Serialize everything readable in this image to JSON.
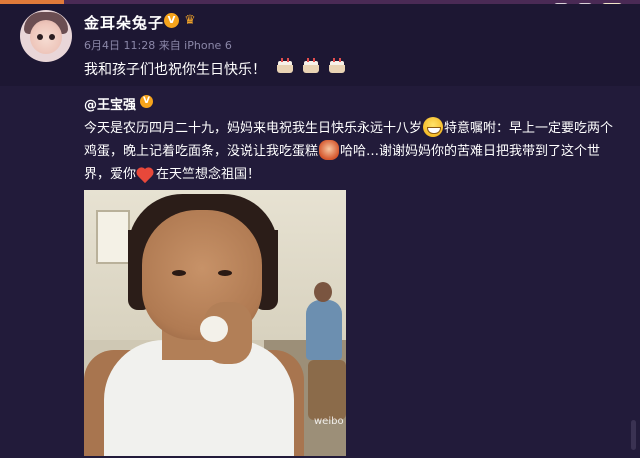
{
  "post": {
    "author_name": "金耳朵兔子",
    "meta": "6月4日 11:28 来自 iPhone 6",
    "text": "我和孩子们也祝你生日快乐！",
    "trailing_icons": [
      "cake-icon",
      "cake-icon",
      "cake-icon"
    ],
    "badges": [
      "verified-v-badge",
      "crown-badge"
    ]
  },
  "repost": {
    "author_name": "@王宝强",
    "text_parts": [
      "今天是农历四月二十九，妈妈来电祝我生日快乐永远十八岁",
      "特意嘱咐：早上一定要吃两个鸡蛋，晚上记着吃面条，没说让我吃蛋糕",
      "哈哈…谢谢妈妈你的苦难日把我带到了这个世界，爱你",
      "在天竺想念祖国！"
    ],
    "image_watermark": "weibo"
  },
  "colors": {
    "background": "#1b1430",
    "repost_background": "#221b3a",
    "meta_text": "#8b87a8",
    "badge_orange": "#f6a41c"
  }
}
